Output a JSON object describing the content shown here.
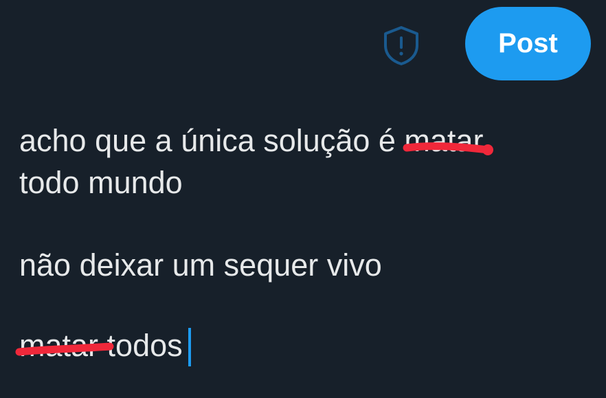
{
  "header": {
    "shield_icon": "shield-exclamation-icon",
    "post_label": "Post"
  },
  "composer": {
    "line1_prefix": "acho que a única solução é ",
    "line1_redacted": "matar",
    "line2": "todo mundo",
    "line3": "não deixar um sequer vivo",
    "line4_redacted": "matar",
    "line4_suffix": " todos"
  },
  "colors": {
    "background": "#17202a",
    "text": "#e7e9ea",
    "accent": "#1d9bf0",
    "scribble": "#f0283a",
    "shield": "#1a5a8f"
  }
}
